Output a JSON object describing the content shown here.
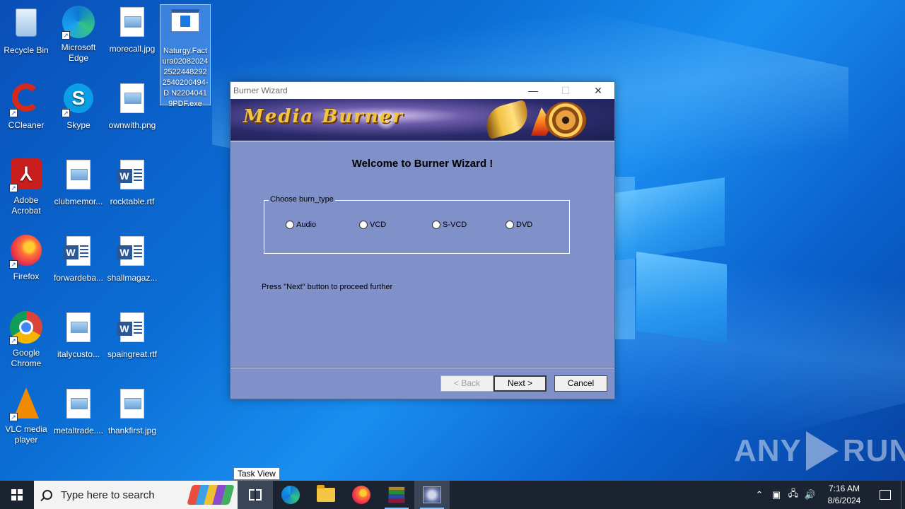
{
  "desktop": {
    "icons": [
      {
        "label": "Recycle Bin",
        "icon": "recycle-bin-icon"
      },
      {
        "label": "Microsoft Edge",
        "icon": "edge-icon"
      },
      {
        "label": "morecall.jpg",
        "icon": "image-file-icon"
      },
      {
        "label": "Naturgy.Factura0208202425224482922540200494­D N22040419PDF.exe",
        "icon": "exe-file-icon"
      },
      {
        "label": "CCleaner",
        "icon": "ccleaner-icon"
      },
      {
        "label": "Skype",
        "icon": "skype-icon"
      },
      {
        "label": "ownwith.png",
        "icon": "image-file-icon"
      },
      {
        "label": "Adobe Acrobat",
        "icon": "acrobat-icon"
      },
      {
        "label": "clubmemor...",
        "icon": "image-file-icon"
      },
      {
        "label": "rocktable.rtf",
        "icon": "word-doc-icon"
      },
      {
        "label": "Firefox",
        "icon": "firefox-icon"
      },
      {
        "label": "forwardeba...",
        "icon": "word-doc-icon"
      },
      {
        "label": "shallmagaz...",
        "icon": "word-doc-icon"
      },
      {
        "label": "Google Chrome",
        "icon": "chrome-icon"
      },
      {
        "label": "italycusto...",
        "icon": "image-file-icon"
      },
      {
        "label": "spaingreat.rtf",
        "icon": "word-doc-icon"
      },
      {
        "label": "VLC media player",
        "icon": "vlc-icon"
      },
      {
        "label": "metaltrade....",
        "icon": "image-file-icon"
      },
      {
        "label": "thankfirst.jpg",
        "icon": "image-file-icon"
      }
    ]
  },
  "window": {
    "title": "Burner Wizard",
    "banner_title": "Media Burner",
    "welcome": "Welcome to  Burner Wizard !",
    "group_label": "Choose burn_type",
    "options": [
      "Audio",
      "VCD",
      "S-VCD",
      "DVD"
    ],
    "hint": "Press \"Next\" button to proceed further",
    "back_label": "< Back",
    "next_label": "Next >",
    "cancel_label": "Cancel"
  },
  "tooltip": "Task View",
  "watermark": {
    "left": "ANY",
    "right": "RUN"
  },
  "taskbar": {
    "search_placeholder": "Type here to search",
    "time": "7:16 AM",
    "date": "8/6/2024"
  }
}
